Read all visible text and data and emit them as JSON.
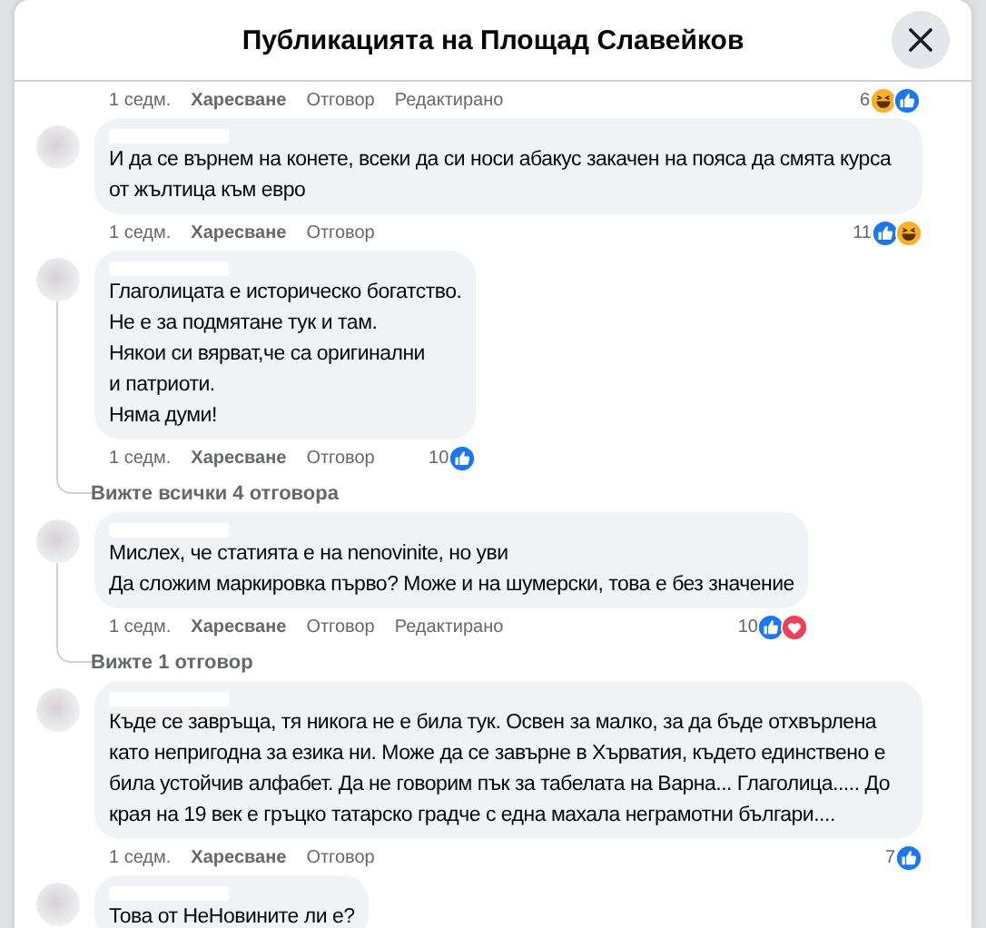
{
  "dialog": {
    "title": "Публикацията на Площад Славейков"
  },
  "comments": [
    {
      "kind": "meta_only",
      "time": "1 седм.",
      "like_label": "Харесване",
      "reply_label": "Отговор",
      "edited": "Редактирано",
      "reaction_count": "6",
      "reactions": [
        {
          "kind": "haha"
        },
        {
          "kind": "like"
        }
      ]
    },
    {
      "kind": "full",
      "text": "И да се върнем на конете, всеки да си носи абакус закачен на пояса да смята курса от жълтица към евро",
      "time": "1 седм.",
      "like_label": "Харесване",
      "reply_label": "Отговор",
      "reaction_count": "11",
      "reactions": [
        {
          "kind": "like"
        },
        {
          "kind": "haha"
        }
      ]
    },
    {
      "kind": "full",
      "text": "Глаголицата е историческо богатство.\nНе е за подмятане тук и там.\nНякои си вярват,че са оригинални\nи патриоти.\nНяма думи!",
      "time": "1 седм.",
      "like_label": "Харесване",
      "reply_label": "Отговор",
      "reaction_count": "10",
      "reactions": [
        {
          "kind": "like"
        }
      ],
      "view_replies": "Вижте всички 4 отговора"
    },
    {
      "kind": "full",
      "text": "Мислех, че статията е на nenovinite, но уви\nДа сложим маркировка първо? Може и на шумерски, това е без значение",
      "time": "1 седм.",
      "like_label": "Харесване",
      "reply_label": "Отговор",
      "edited": "Редактирано",
      "reaction_count": "10",
      "reactions": [
        {
          "kind": "like"
        },
        {
          "kind": "love"
        }
      ],
      "view_replies": "Вижте 1 отговор"
    },
    {
      "kind": "full",
      "text": "Къде се завръща, тя никога не е била тук. Освен за малко, за да бъде отхвърлена като непригодна за езика ни. Може да се завърне в Хърватия, където единствено е била устойчив алфабет. Да не говорим пък за табелата на Варна... Глаголица..... До края на 19 век е гръцко татарско градче с една махала неграмотни българи....",
      "time": "1 седм.",
      "like_label": "Харесване",
      "reply_label": "Отговор",
      "reaction_count": "7",
      "reactions": [
        {
          "kind": "like"
        }
      ]
    },
    {
      "kind": "bubble_only",
      "text": "Това от НеНовините ли е?"
    }
  ]
}
